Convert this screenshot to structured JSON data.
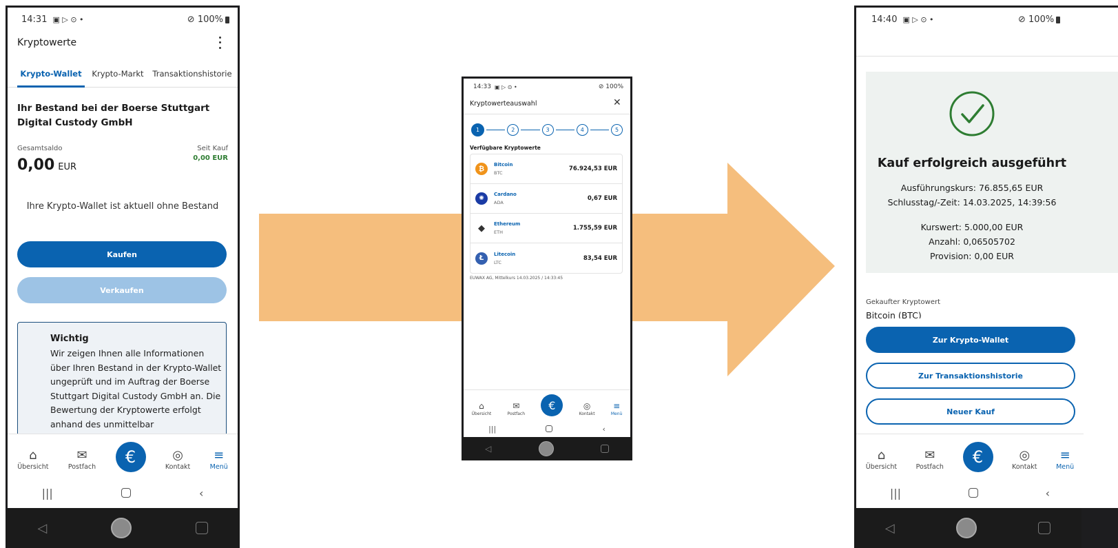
{
  "colors": {
    "brand": "#0a63b0",
    "arrow": "#f5be7d",
    "green": "#2e7d32",
    "success_bg": "#eef2f0"
  },
  "left": {
    "status": {
      "time": "14:31",
      "icons": "▣ ▷ ⊙ •",
      "battery": "⊘ 100%"
    },
    "title": "Kryptowerte",
    "tabs": [
      {
        "label": "Krypto-Wallet",
        "active": true
      },
      {
        "label": "Krypto-Markt",
        "active": false
      },
      {
        "label": "Transaktionshistorie",
        "active": false
      }
    ],
    "holding_heading": "Ihr Bestand bei der Boerse Stuttgart Digital Custody GmbH",
    "balance_label": "Gesamtsaldo",
    "balance_value": "0,00",
    "balance_currency": "EUR",
    "since_label": "Seit Kauf",
    "since_value": "0,00 EUR",
    "empty_text": "Ihre Krypto-Wallet ist aktuell ohne Bestand",
    "buy_label": "Kaufen",
    "sell_label": "Verkaufen",
    "notice_title": "Wichtig",
    "notice_text": "Wir zeigen Ihnen alle Informationen über Ihren Bestand in der Krypto-Wallet ungeprüft und im Auftrag der Boerse Stuttgart Digital Custody GmbH an. Die Bewertung der Kryptowerte erfolgt anhand des unmittelbar"
  },
  "middle": {
    "status": {
      "time": "14:33",
      "icons": "▣ ▷ ⊙ •",
      "battery": "⊘ 100%"
    },
    "title": "Kryptowerteauswahl",
    "steps": [
      "1",
      "2",
      "3",
      "4",
      "5"
    ],
    "list_heading": "Verfügbare Kryptowerte",
    "coins": [
      {
        "name": "Bitcoin",
        "symbol": "BTC",
        "price": "76.924,53 EUR",
        "color": "#f0931a",
        "glyph": "B"
      },
      {
        "name": "Cardano",
        "symbol": "ADA",
        "price": "0,67 EUR",
        "color": "#1a3ba5",
        "glyph": "✺"
      },
      {
        "name": "Ethereum",
        "symbol": "ETH",
        "price": "1.755,59 EUR",
        "color": "#ffffff",
        "glyph": "◆"
      },
      {
        "name": "Litecoin",
        "symbol": "LTC",
        "price": "83,54 EUR",
        "color": "#3460b0",
        "glyph": "Ł"
      }
    ],
    "footnote": "EUWAX AG, Mittelkurs 14.03.2025 / 14:33:45"
  },
  "right": {
    "status": {
      "time": "14:40",
      "icons": "▣ ▷ ⊙ •",
      "battery": "⊘ 100%"
    },
    "success_title": "Kauf erfolgreich ausgeführt",
    "exec_price": "Ausführungskurs: 76.855,65 EUR",
    "close_time": "Schlusstag/-Zeit: 14.03.2025, 14:39:56",
    "market_value": "Kurswert: 5.000,00 EUR",
    "quantity": "Anzahl: 0,06505702",
    "commission": "Provision: 0,00 EUR",
    "bought_label": "Gekaufter Kryptowert",
    "bought_value": "Bitcoin (BTC)",
    "btn_wallet": "Zur Krypto-Wallet",
    "btn_history": "Zur Transaktionshistorie",
    "btn_new": "Neuer Kauf"
  },
  "bottom_nav": [
    {
      "label": "Übersicht",
      "icon": "home-icon"
    },
    {
      "label": "Postfach",
      "icon": "mail-icon"
    },
    {
      "label": "",
      "icon": "euro-icon"
    },
    {
      "label": "Kontakt",
      "icon": "contact-icon"
    },
    {
      "label": "Menü",
      "icon": "menu-icon"
    }
  ]
}
